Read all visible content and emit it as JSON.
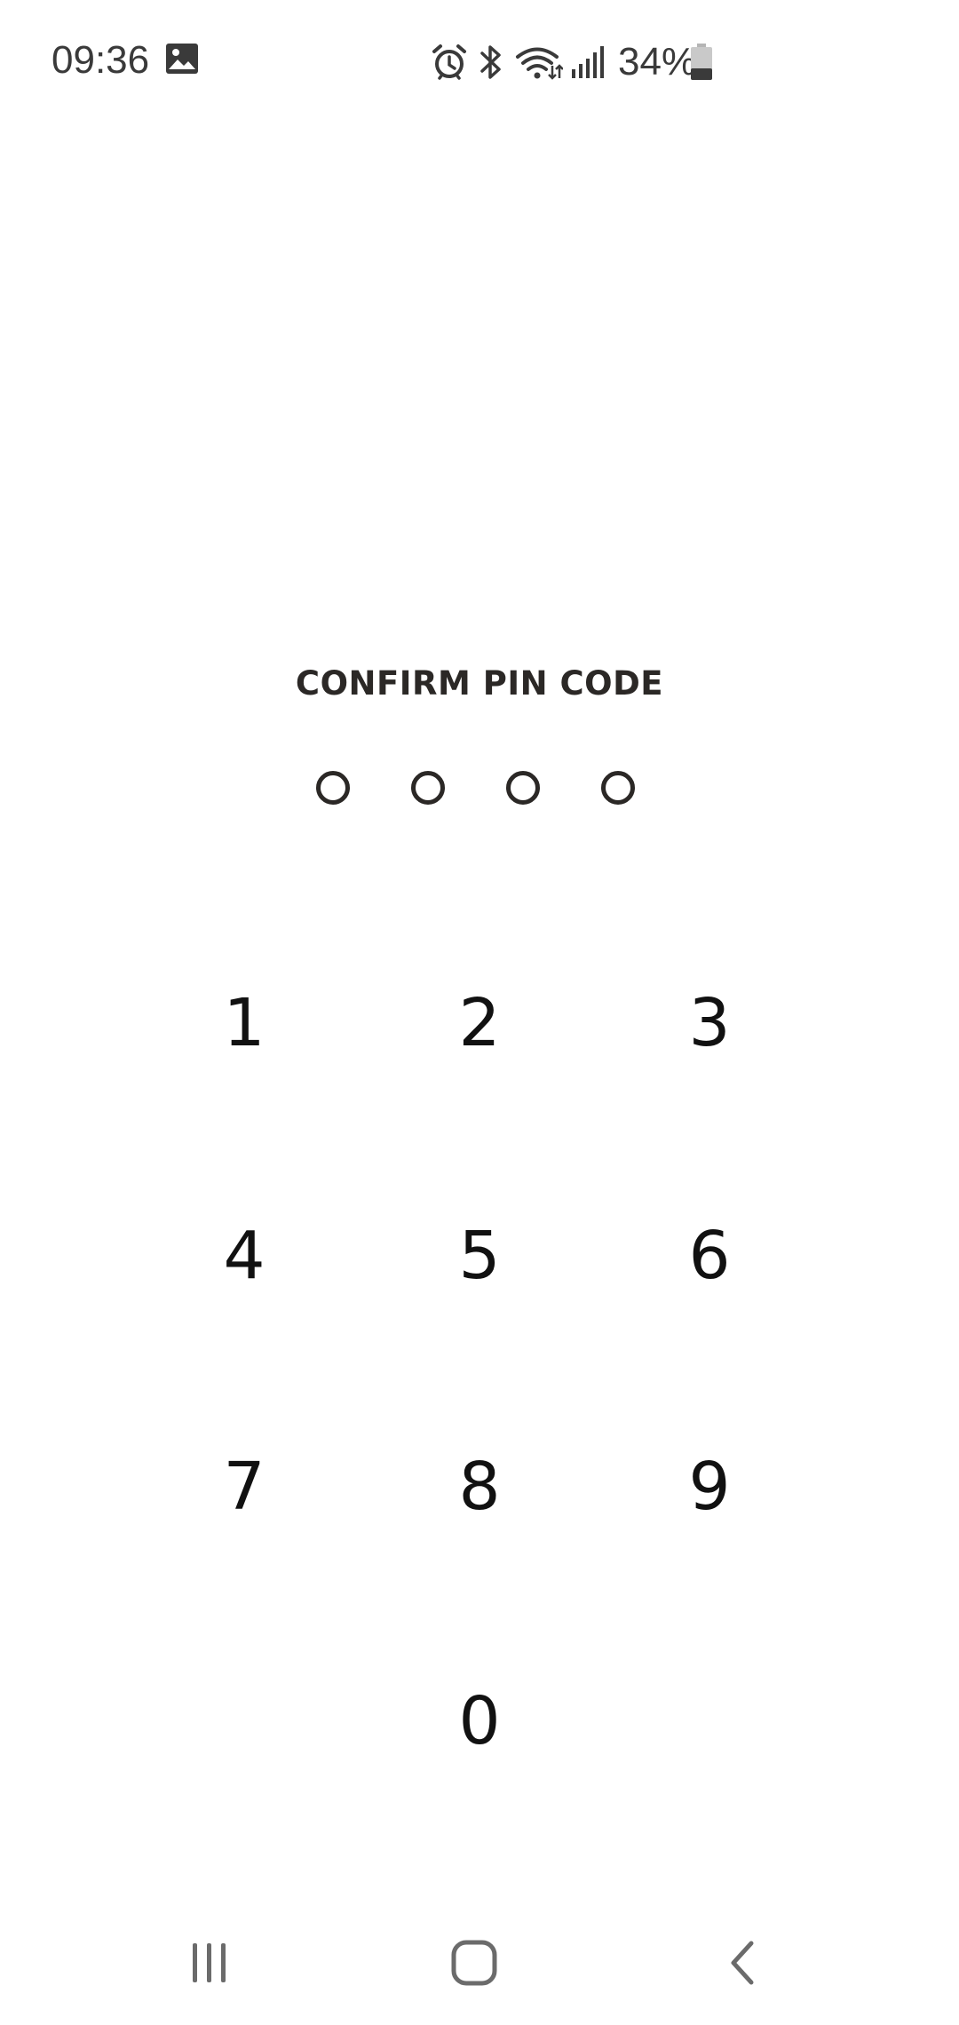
{
  "status_bar": {
    "time": "09:36",
    "battery_percent": "34%",
    "battery_level": 0.34,
    "icons": [
      "gallery-icon",
      "alarm-icon",
      "bluetooth-icon",
      "wifi-icon",
      "signal-icon",
      "battery-icon"
    ]
  },
  "pin": {
    "title": "CONFIRM PIN CODE",
    "length": 4,
    "entered": 0
  },
  "keypad": {
    "keys": [
      "1",
      "2",
      "3",
      "4",
      "5",
      "6",
      "7",
      "8",
      "9",
      "0"
    ]
  },
  "nav_bar": {
    "icons": [
      "recent-apps-icon",
      "home-icon",
      "back-icon"
    ]
  },
  "colors": {
    "background": "#ffffff",
    "text": "#2b2826",
    "status_text": "#3a3a3a",
    "nav_icon": "#6b6b6b"
  }
}
